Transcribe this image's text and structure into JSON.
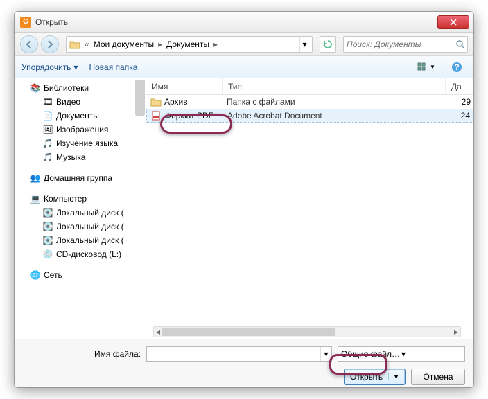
{
  "window": {
    "title": "Открыть"
  },
  "breadcrumb": {
    "prefix": "«",
    "p1": "Мои документы",
    "p2": "Документы"
  },
  "search": {
    "placeholder": "Поиск: Документы"
  },
  "toolbar": {
    "organize": "Упорядочить",
    "newfolder": "Новая папка"
  },
  "tree": {
    "lib": "Библиотеки",
    "video": "Видео",
    "docs": "Документы",
    "images": "Изображения",
    "lang": "Изучение языка",
    "music": "Музыка",
    "homegroup": "Домашняя группа",
    "computer": "Компьютер",
    "disk1": "Локальный диск (",
    "disk2": "Локальный диск (",
    "disk3": "Локальный диск (",
    "cd": "CD-дисковод (L:)",
    "network": "Сеть"
  },
  "columns": {
    "name": "Имя",
    "type": "Тип",
    "date": "Да"
  },
  "files": [
    {
      "name": "Архив",
      "type": "Папка с файлами",
      "date": "29"
    },
    {
      "name": "Формат PDF",
      "type": "Adobe Acrobat Document",
      "date": "24"
    }
  ],
  "bottom": {
    "filenameLabel": "Имя файла:",
    "filenameValue": "",
    "filter": "Общие файлы (*.pdf *.fdf *.xfd",
    "open": "Открыть",
    "cancel": "Отмена"
  }
}
